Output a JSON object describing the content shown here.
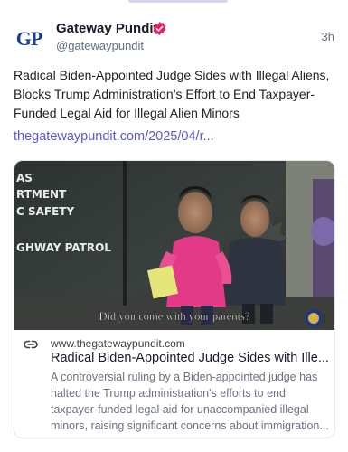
{
  "post": {
    "author_name": "Gateway Pundit",
    "author_handle": "@gatewaypundit",
    "avatar_text": "GP",
    "time": "3h",
    "text": "Radical Biden-Appointed Judge Sides with Illegal Aliens, Blocks Trump Administration’s Effort to End Taxpayer-Funded Legal Aid for Illegal Alien Minors",
    "link": "thegatewaypundit.com/2025/04/r..."
  },
  "card": {
    "domain": "www.thegatewaypundit.com",
    "title": "Radical Biden-Appointed Judge Sides with Ille...",
    "description": "A controversial ruling by a Biden-appointed judge has halted the Trump administration's efforts to end taxpayer-funded legal aid for unaccompanied illegal minors, raising significant concerns about immigration...",
    "image_texts": {
      "door_line1": "AS",
      "door_line2": "RTMENT",
      "door_line3": "C SAFETY",
      "door_line4": "GHWAY PATROL",
      "subtitle": "Did you come with your parents?"
    }
  },
  "colors": {
    "accent": "#5a58d6",
    "verified": "#e0245e",
    "brand": "#1d3f8a"
  },
  "icons": [
    "verified-badge-icon",
    "link-icon"
  ]
}
